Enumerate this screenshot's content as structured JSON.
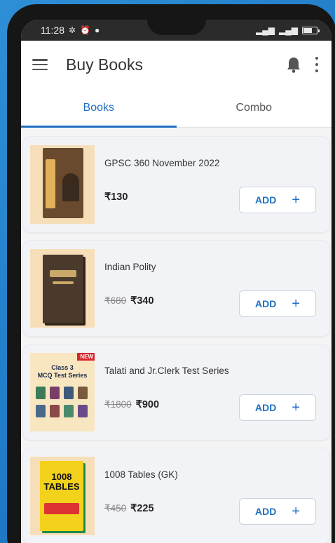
{
  "status_bar": {
    "time": "11:28"
  },
  "app_bar": {
    "title": "Buy Books"
  },
  "tabs": [
    {
      "label": "Books",
      "active": true
    },
    {
      "label": "Combo",
      "active": false
    }
  ],
  "books": [
    {
      "title": "GPSC 360 November 2022",
      "mrp": "",
      "price": "₹130",
      "add_label": "ADD",
      "add_icon": "+"
    },
    {
      "title": "Indian Polity",
      "mrp": "₹680",
      "price": "₹340",
      "add_label": "ADD",
      "add_icon": "+"
    },
    {
      "title": "Talati and Jr.Clerk Test Series",
      "mrp": "₹1800",
      "price": "₹900",
      "add_label": "ADD",
      "add_icon": "+",
      "badge": "NEW",
      "cover_text": "Class 3\nMCQ Test Series"
    },
    {
      "title": "1008 Tables (GK)",
      "mrp": "₹450",
      "price": "₹225",
      "add_label": "ADD",
      "add_icon": "+",
      "cover_text": "1008 TABLES"
    }
  ],
  "colors": {
    "accent": "#1f6fc0",
    "background": "#2f8fd6",
    "new_badge": "#d7262b"
  }
}
